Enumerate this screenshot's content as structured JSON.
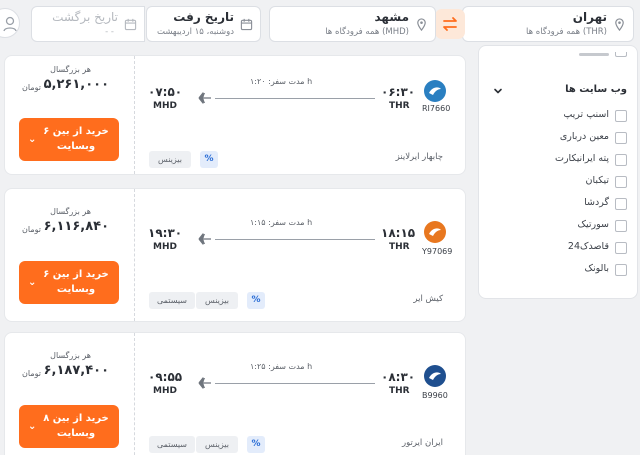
{
  "search": {
    "origin": {
      "city": "تهران",
      "sub": "همه فرودگاه ها (THR)"
    },
    "destination": {
      "city": "مشهد",
      "sub": "همه فرودگاه ها (MHD)"
    },
    "depart": {
      "label": "تاریخ رفت",
      "value": "دوشنبه، ۱۵ اردیبهشت"
    },
    "return": {
      "label": "تاریخ برگشت",
      "value": "- -"
    }
  },
  "filters": {
    "title": "وب سایت ها",
    "items": [
      "اسنپ تریپ",
      "معین درباری",
      "پته ایرانیکارت",
      "تیکبان",
      "گردشا",
      "سورتیک",
      "قاصدک24",
      "بالونک"
    ]
  },
  "colors": {
    "accent": "#ff6d1d",
    "swap_bg": "#fde8d9"
  },
  "flights": [
    {
      "per_adult": "هر بزرگسال",
      "price": "۵,۲۶۱,۰۰۰",
      "currency": "تومان",
      "buy_label": "خرید از بین ۶ وبسایت",
      "arrive_time": "۰۷:۵۰",
      "arrive_code": "MHD",
      "depart_time": "۰۶:۳۰",
      "depart_code": "THR",
      "duration": "مدت سفر: ۱:۲۰ h",
      "flight_no": "RI7660",
      "airline": "چابهار ایرلاینز",
      "tags": [
        "بیزینس"
      ],
      "logo_color": "#2a7fc1",
      "logo_icon": "airline-logo-icon"
    },
    {
      "per_adult": "هر بزرگسال",
      "price": "۶,۱۱۶,۸۴۰",
      "currency": "تومان",
      "buy_label": "خرید از بین ۶ وبسایت",
      "arrive_time": "۱۹:۳۰",
      "arrive_code": "MHD",
      "depart_time": "۱۸:۱۵",
      "depart_code": "THR",
      "duration": "مدت سفر: ۱:۱۵ h",
      "flight_no": "Y97069",
      "airline": "کیش ایر",
      "tags": [
        "سیستمی",
        "بیزینس"
      ],
      "logo_color": "#e8771f",
      "logo_icon": "airline-logo-icon"
    },
    {
      "per_adult": "هر بزرگسال",
      "price": "۶,۱۸۷,۴۰۰",
      "currency": "تومان",
      "buy_label": "خرید از بین ۸ وبسایت",
      "arrive_time": "۰۹:۵۵",
      "arrive_code": "MHD",
      "depart_time": "۰۸:۳۰",
      "depart_code": "THR",
      "duration": "مدت سفر: ۱:۲۵ h",
      "flight_no": "B9960",
      "airline": "ایران ایرتور",
      "tags": [
        "سیستمی",
        "بیزینس"
      ],
      "logo_color": "#1f4f8f",
      "logo_icon": "airline-logo-icon"
    }
  ]
}
